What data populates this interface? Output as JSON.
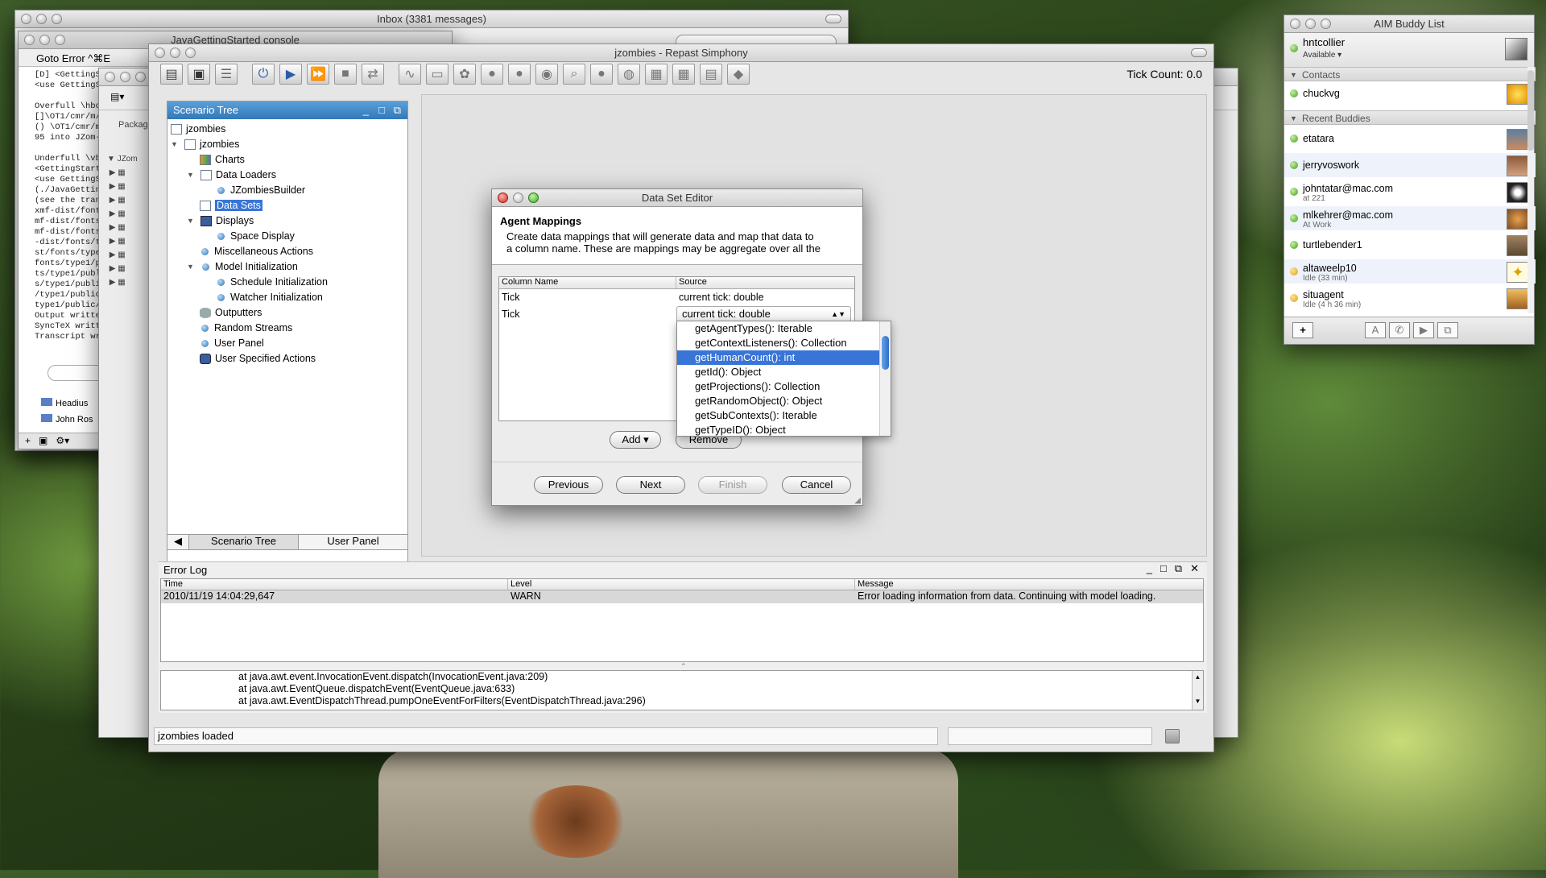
{
  "windows": {
    "inbox": {
      "title": "Inbox (3381 messages)"
    },
    "console": {
      "title": "JavaGettingStarted console",
      "goto_error": "Goto Error ^⌘E",
      "log_lines": [
        "[D] <GettingS",
        "<use GettingS",
        "",
        "Overfull \\hbo",
        "[]\\OT1/cmr/m/",
        "() \\OT1/cmr/m/",
        "95 into JZom-",
        "",
        "Underfull \\vbo",
        "<GettingStarte",
        "<use GettingS",
        "(./JavaGettin",
        "(see the trans",
        "xmf-dist/font",
        "mf-dist/fonts",
        "mf-dist/fonts",
        "-dist/fonts/ty",
        "st/fonts/type",
        "fonts/type1/p",
        "ts/type1/publ",
        "s/type1/publi",
        "/type1/public",
        "type1/public/",
        "Output writte",
        "SyncTeX writt",
        "Transcript wr"
      ],
      "feeds": [
        "Headius",
        "John Ros"
      ]
    },
    "eclipse": {
      "package_tab": "Packag",
      "tree_root": "JZom"
    }
  },
  "repast": {
    "title": "jzombies - Repast Simphony",
    "tick_count": "Tick Count: 0.0",
    "scenario_tree": {
      "title": "Scenario Tree",
      "root": "jzombies",
      "project": "jzombies",
      "items": {
        "charts": "Charts",
        "data_loaders": "Data Loaders",
        "builder": "JZombiesBuilder",
        "data_sets": "Data Sets",
        "displays": "Displays",
        "space_display": "Space Display",
        "misc": "Miscellaneous Actions",
        "model_init": "Model Initialization",
        "schedule_init": "Schedule Initialization",
        "watcher_init": "Watcher Initialization",
        "outputters": "Outputters",
        "random_streams": "Random Streams",
        "user_panel": "User Panel",
        "user_actions": "User Specified Actions"
      },
      "tabs": [
        "Scenario Tree",
        "User Panel"
      ]
    },
    "error_log": {
      "title": "Error Log",
      "columns": [
        "Time",
        "Level",
        "Message"
      ],
      "rows": [
        {
          "time": "2010/11/19 14:04:29,647",
          "level": "WARN",
          "message": "Error loading information from data. Continuing with model loading."
        }
      ],
      "trace": [
        "at java.awt.event.InvocationEvent.dispatch(InvocationEvent.java:209)",
        "at java.awt.EventQueue.dispatchEvent(EventQueue.java:633)",
        "at java.awt.EventDispatchThread.pumpOneEventForFilters(EventDispatchThread.java:296)"
      ]
    },
    "status": "jzombies loaded"
  },
  "dialog": {
    "title": "Data Set Editor",
    "heading": "Agent Mappings",
    "description_1": "Create data mappings that will generate data and map that data to",
    "description_2": "a column name. These are mappings may be aggregate over all the",
    "columns": [
      "Column Name",
      "Source"
    ],
    "rows": [
      {
        "name": "Tick",
        "source": "current tick: double"
      },
      {
        "name": "Tick",
        "source": "current tick: double"
      }
    ],
    "dropdown_options": [
      "getAgentTypes(): Iterable",
      "getContextListeners(): Collection",
      "getHumanCount(): int",
      "getId(): Object",
      "getProjections(): Collection",
      "getRandomObject(): Object",
      "getSubContexts(): Iterable",
      "getTypeID(): Object"
    ],
    "selected_option": "getHumanCount(): int",
    "buttons": {
      "add": "Add",
      "remove": "Remove",
      "previous": "Previous",
      "next": "Next",
      "finish": "Finish",
      "cancel": "Cancel"
    }
  },
  "aim": {
    "title": "AIM Buddy List",
    "user": {
      "name": "hntcollier",
      "status": "Available"
    },
    "groups": {
      "contacts": "Contacts",
      "recent": "Recent Buddies"
    },
    "contacts": [
      {
        "name": "chuckvg"
      }
    ],
    "recent": [
      {
        "name": "etatara",
        "sub": ""
      },
      {
        "name": "jerryvoswork",
        "sub": ""
      },
      {
        "name": "johntatar@mac.com",
        "sub": "at 221"
      },
      {
        "name": "mlkehrer@mac.com",
        "sub": "At Work"
      },
      {
        "name": "turtlebender1",
        "sub": ""
      },
      {
        "name": "altaweelp10",
        "sub": "Idle (33 min)"
      },
      {
        "name": "situagent",
        "sub": "Idle (4 h 36 min)"
      }
    ]
  },
  "colors": {
    "selection": "#3875d7",
    "tree_header": "#4a8fc9",
    "online": "#3c9d1e",
    "idle": "#e39b11"
  }
}
